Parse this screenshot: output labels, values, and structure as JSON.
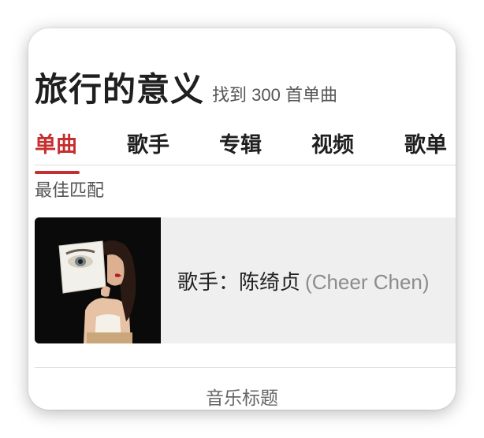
{
  "header": {
    "title": "旅行的意义",
    "result_count": "找到 300 首单曲"
  },
  "tabs": [
    {
      "label": "单曲",
      "active": true
    },
    {
      "label": "歌手",
      "active": false
    },
    {
      "label": "专辑",
      "active": false
    },
    {
      "label": "视频",
      "active": false
    },
    {
      "label": "歌单",
      "active": false
    }
  ],
  "best_match": {
    "section_label": "最佳匹配",
    "artist_prefix": "歌手：",
    "artist_name": "陈绮贞",
    "artist_alias": "(Cheer Chen)"
  },
  "footer": {
    "label": "音乐标题"
  },
  "colors": {
    "accent": "#c62f2f",
    "card_bg": "#efefef"
  }
}
